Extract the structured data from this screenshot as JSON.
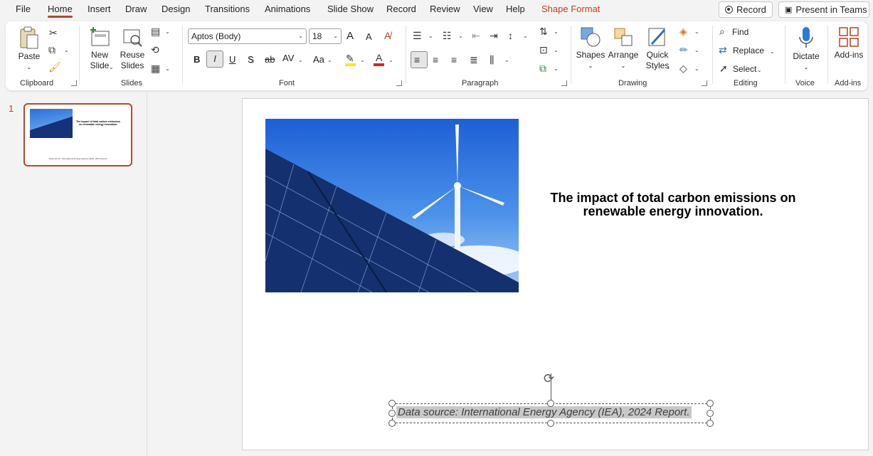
{
  "menu": {
    "file": "File",
    "home": "Home",
    "insert": "Insert",
    "draw": "Draw",
    "design": "Design",
    "transitions": "Transitions",
    "animations": "Animations",
    "slideshow": "Slide Show",
    "record": "Record",
    "review": "Review",
    "view": "View",
    "help": "Help",
    "shape_format": "Shape Format"
  },
  "top_buttons": {
    "record": "Record",
    "present": "Present in Teams"
  },
  "ribbon": {
    "clipboard": {
      "paste": "Paste",
      "label": "Clipboard"
    },
    "slides": {
      "new_slide_1": "New",
      "new_slide_2": "Slide",
      "reuse_1": "Reuse",
      "reuse_2": "Slides",
      "label": "Slides"
    },
    "font": {
      "family": "Aptos (Body)",
      "size": "18",
      "bold": "B",
      "italic": "I",
      "underline": "U",
      "shadow": "S",
      "strike": "ab",
      "spacing": "AV",
      "case": "Aa",
      "grow": "A",
      "shrink": "A",
      "label": "Font"
    },
    "paragraph": {
      "label": "Paragraph"
    },
    "drawing": {
      "shapes": "Shapes",
      "arrange": "Arrange",
      "quick_1": "Quick",
      "quick_2": "Styles",
      "label": "Drawing"
    },
    "editing": {
      "find": "Find",
      "replace": "Replace",
      "select": "Select",
      "label": "Editing"
    },
    "voice": {
      "dictate": "Dictate",
      "label": "Voice"
    },
    "addins": {
      "addins": "Add-ins",
      "label": "Add-ins"
    }
  },
  "slide_pane": {
    "number": "1"
  },
  "slide": {
    "title": "The impact of total carbon emissions on renewable energy innovation.",
    "source": "Data source: International Energy Agency (IEA), 2024 Report."
  },
  "thumbnail": {
    "title": "The impact of total carbon emissions on renewable energy innovation.",
    "source": "Data source: International Energy Agency (IEA), 2024 Report."
  },
  "colors": {
    "accent": "#b7472a",
    "shape_format": "#c43e1c"
  }
}
